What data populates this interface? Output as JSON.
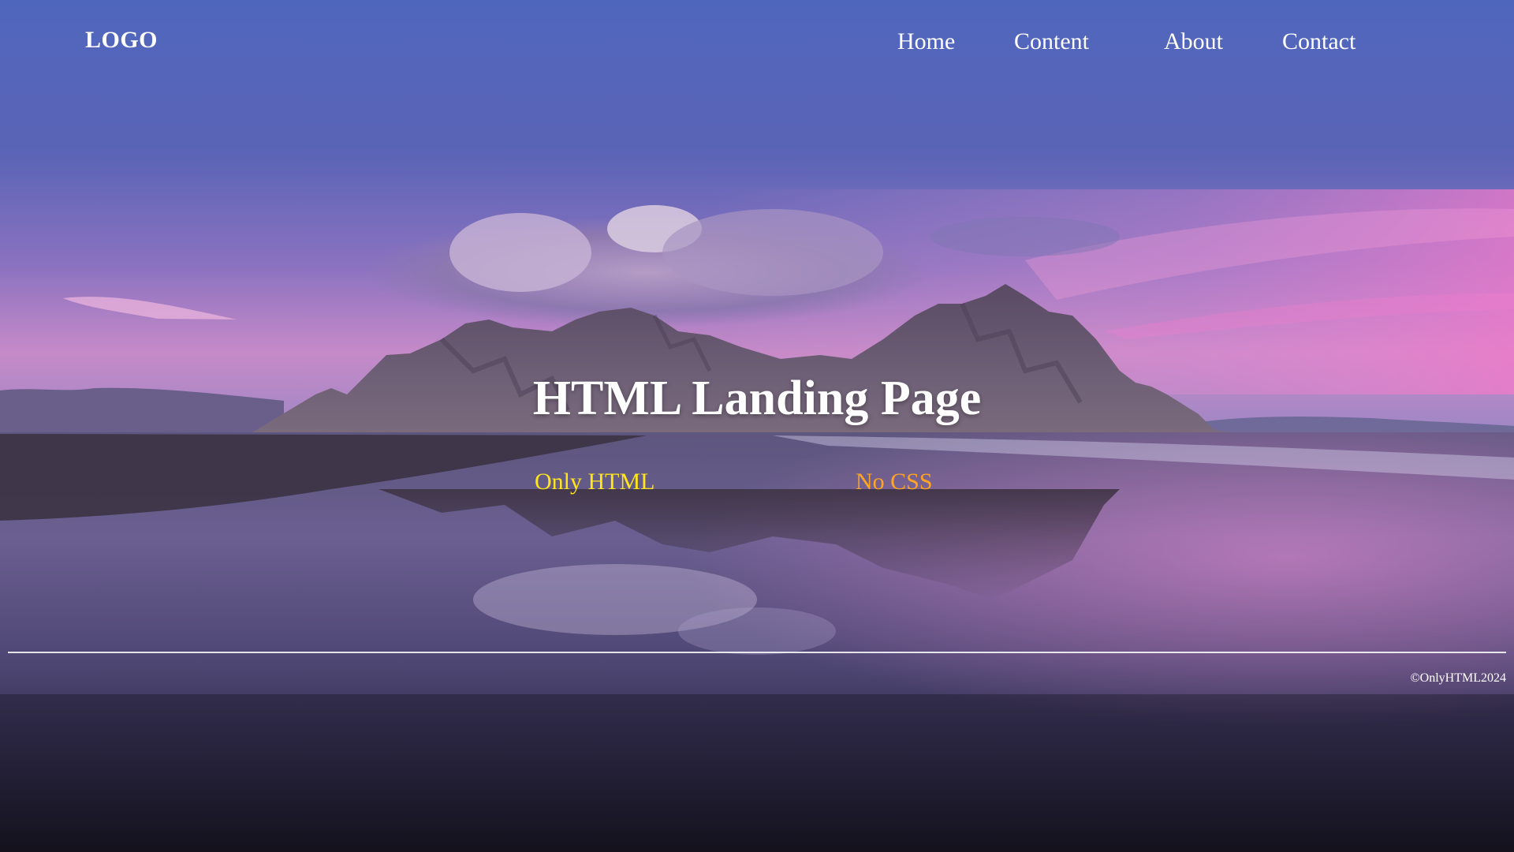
{
  "header": {
    "logo": "LOGO",
    "nav": [
      "Home",
      "Content",
      "About",
      "Contact"
    ]
  },
  "hero": {
    "title": "HTML Landing Page",
    "tags": [
      "Only HTML",
      "No CSS"
    ]
  },
  "footer": {
    "copyright": "©OnlyHTML2024"
  },
  "colors": {
    "text": "#ffffff",
    "tag_html": "#ffe51a",
    "tag_css": "#ffa423",
    "sky_top": "#5267be",
    "sky_horizon": "#d98bd0",
    "beach": "#2c2744"
  },
  "background": "mountain-beach-sunset-image"
}
